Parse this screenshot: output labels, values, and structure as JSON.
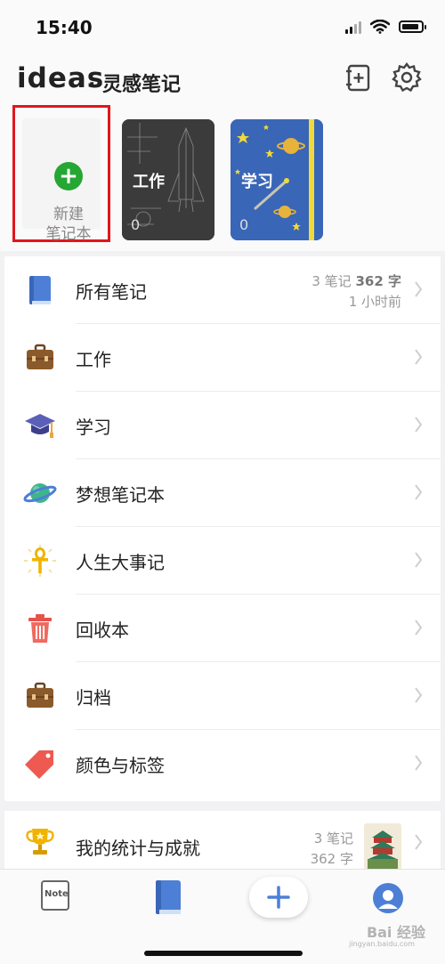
{
  "status": {
    "time": "15:40"
  },
  "header": {
    "app_name": "ideas",
    "subtitle": "· 灵感笔记"
  },
  "notebooks": {
    "new_label_line1": "新建",
    "new_label_line2": "笔记本",
    "items": [
      {
        "title": "工作",
        "count": "0",
        "cover": "rocket-blueprint"
      },
      {
        "title": "学习",
        "count": "0",
        "cover": "starry-sky"
      }
    ]
  },
  "list": {
    "items": [
      {
        "label": "所有笔记",
        "icon": "book-icon",
        "notes": "3 笔记",
        "chars": "362 字",
        "time": "1 小时前"
      },
      {
        "label": "工作",
        "icon": "briefcase-icon"
      },
      {
        "label": "学习",
        "icon": "graduation-cap-icon"
      },
      {
        "label": "梦想笔记本",
        "icon": "planet-icon"
      },
      {
        "label": "人生大事记",
        "icon": "ankh-icon"
      },
      {
        "label": "回收本",
        "icon": "trash-icon"
      },
      {
        "label": "归档",
        "icon": "briefcase-icon"
      },
      {
        "label": "颜色与标签",
        "icon": "tag-icon"
      }
    ]
  },
  "stats": {
    "label": "我的统计与成就",
    "notes": "3 笔记",
    "chars": "362 字",
    "icon": "trophy-icon"
  },
  "tabbar": {
    "note_label": "Note",
    "icons": [
      "note-icon",
      "notebook-icon",
      "add-icon",
      "profile-icon"
    ]
  },
  "watermark": {
    "text": "Bai 经验",
    "sub": "jingyan.baidu.com"
  },
  "colors": {
    "accent_green": "#26a633",
    "highlight_red": "#e0161b",
    "blue": "#4a7fd4"
  }
}
